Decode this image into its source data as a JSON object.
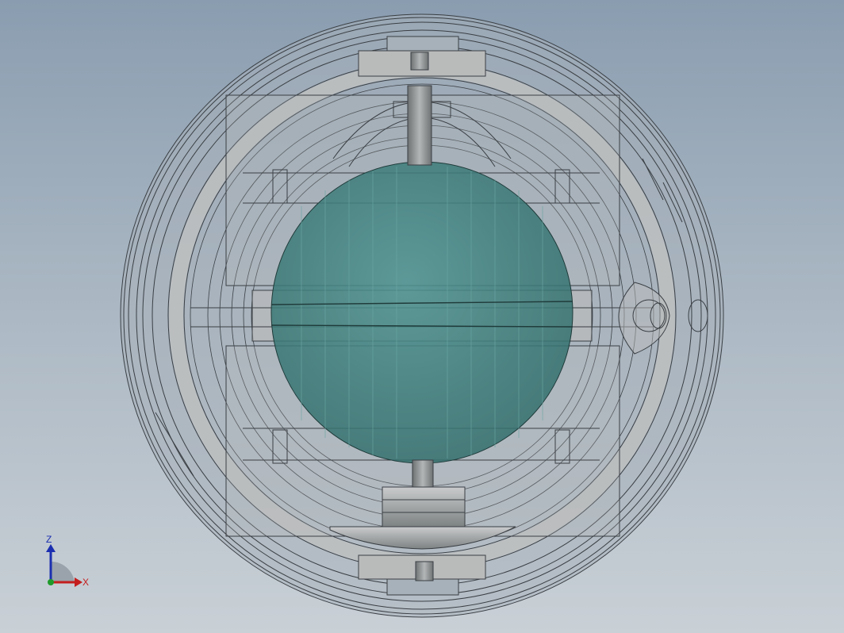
{
  "viewport": {
    "colors": {
      "background_top": "#8a9db0",
      "background_bottom": "#c9d0d6",
      "shell_fill": "#aab3ba",
      "line": "#3a3f44",
      "ring_fill": "#b9bbbb",
      "sphere_fill": "#3f7f7c",
      "shaft_fill": "#8d9091"
    }
  },
  "triad": {
    "z_label": "Z",
    "x_label": "X",
    "colors": {
      "z": "#1b2fb0",
      "x": "#c41e1e",
      "y": "#1e9a2a"
    }
  }
}
